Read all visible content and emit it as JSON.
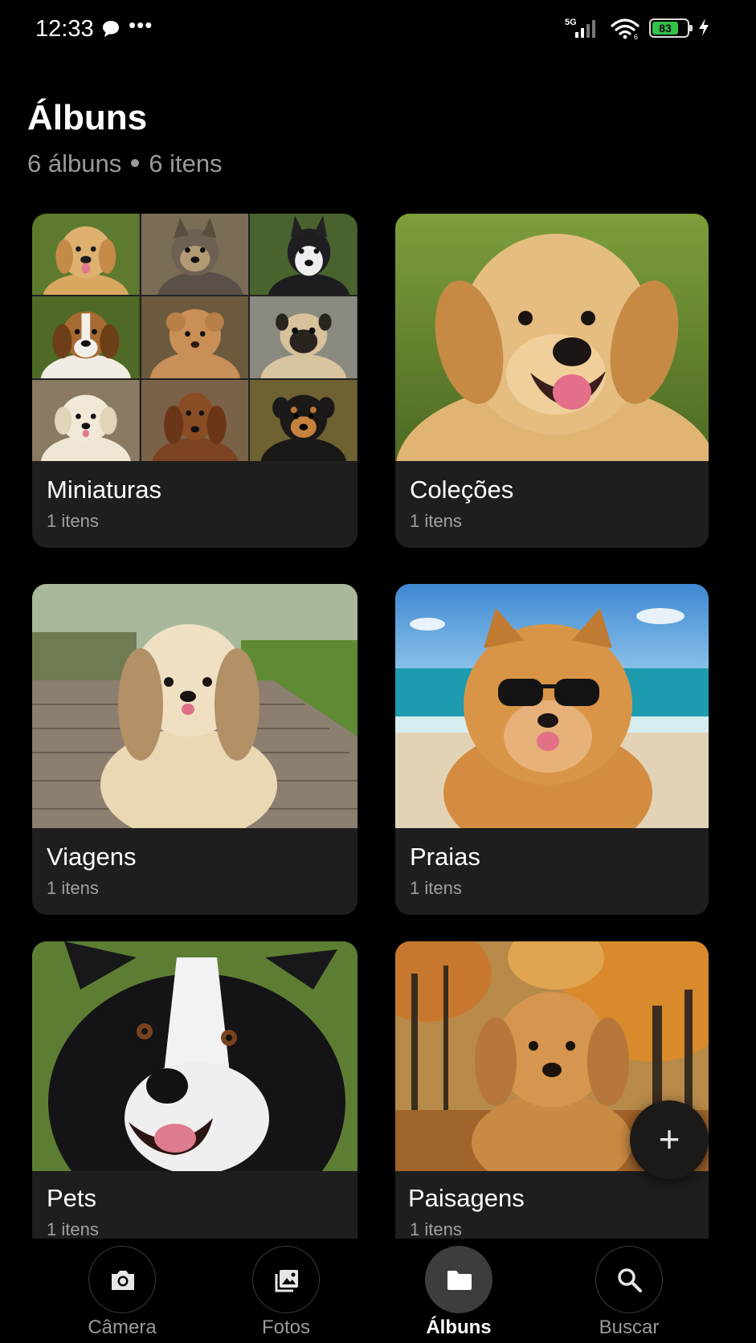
{
  "status_bar": {
    "time": "12:33",
    "overflow_dots": "•••",
    "network_label": "5G",
    "battery_level": "83",
    "battery_fill_percent": 83,
    "colors": {
      "battery": "#35c04a"
    }
  },
  "header": {
    "title": "Álbuns",
    "summary_albums": "6 álbuns",
    "summary_items": "6 itens"
  },
  "albums": [
    {
      "name": "Miniaturas",
      "count": "1 itens",
      "cover": "mosaic"
    },
    {
      "name": "Coleções",
      "count": "1 itens",
      "cover": "golden-puppy-photo"
    },
    {
      "name": "Viagens",
      "count": "1 itens",
      "cover": "shih-tzu-boardwalk-photo"
    },
    {
      "name": "Praias",
      "count": "1 itens",
      "cover": "pomeranian-beach-sunglasses-photo"
    },
    {
      "name": "Pets",
      "count": "1 itens",
      "cover": "border-collie-photo"
    },
    {
      "name": "Paisagens",
      "count": "1 itens",
      "cover": "golden-puppy-autumn-photo"
    }
  ],
  "fab": {
    "icon": "plus-icon",
    "symbol": "+"
  },
  "bottom_nav": {
    "items": [
      {
        "label": "Câmera",
        "icon": "camera-icon"
      },
      {
        "label": "Fotos",
        "icon": "photos-icon"
      },
      {
        "label": "Álbuns",
        "icon": "folder-icon",
        "active": true
      },
      {
        "label": "Buscar",
        "icon": "search-icon"
      }
    ]
  }
}
